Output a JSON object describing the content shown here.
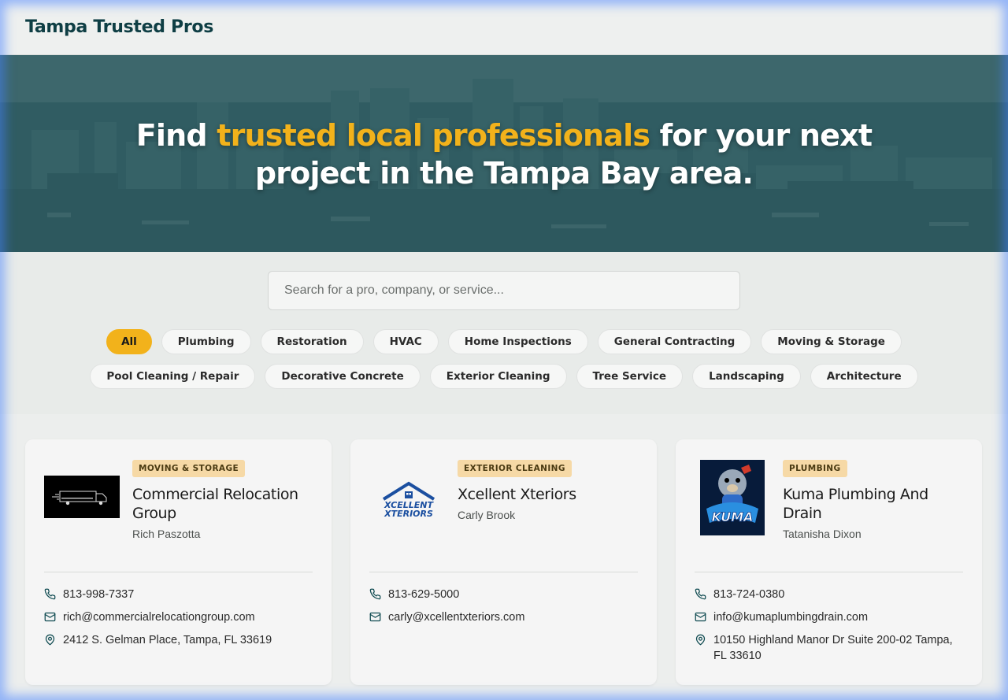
{
  "header": {
    "brand": "Tampa Trusted Pros"
  },
  "hero": {
    "title_part1": "Find ",
    "title_highlight": "trusted local professionals",
    "title_part2": " for your next",
    "title_line2": "project in the Tampa Bay area."
  },
  "search": {
    "placeholder": "Search for a pro, company, or service..."
  },
  "filters": [
    "All",
    "Plumbing",
    "Restoration",
    "HVAC",
    "Home Inspections",
    "General Contracting",
    "Moving & Storage",
    "Pool Cleaning / Repair",
    "Decorative Concrete",
    "Exterior Cleaning",
    "Tree Service",
    "Landscaping",
    "Architecture"
  ],
  "active_filter": "All",
  "colors": {
    "accent": "#f2b21b",
    "brand": "#0e3e44",
    "badge_bg": "#f6d9a6"
  },
  "listings": [
    {
      "category": "MOVING & STORAGE",
      "company": "Commercial Relocation Group",
      "contact": "Rich Paszotta",
      "phone": "813-998-7337",
      "email": "rich@commercialrelocationgroup.com",
      "address": "2412 S. Gelman Place, Tampa, FL 33619",
      "logo_icon": "truck-logo-icon"
    },
    {
      "category": "EXTERIOR CLEANING",
      "company": "Xcellent Xteriors",
      "contact": "Carly Brook",
      "phone": "813-629-5000",
      "email": "carly@xcellentxteriors.com",
      "logo_icon": "house-logo-icon",
      "logo_text_1": "XCELLENT",
      "logo_text_2": "XTERIORS"
    },
    {
      "category": "PLUMBING",
      "company": "Kuma Plumbing And Drain",
      "contact": "Tatanisha Dixon",
      "phone": "813-724-0380",
      "email": "info@kumaplumbingdrain.com",
      "address": "10150 Highland Manor Dr Suite 200-02 Tampa, FL 33610",
      "logo_icon": "bear-mascot-logo-icon",
      "logo_text": "KUMA"
    }
  ]
}
